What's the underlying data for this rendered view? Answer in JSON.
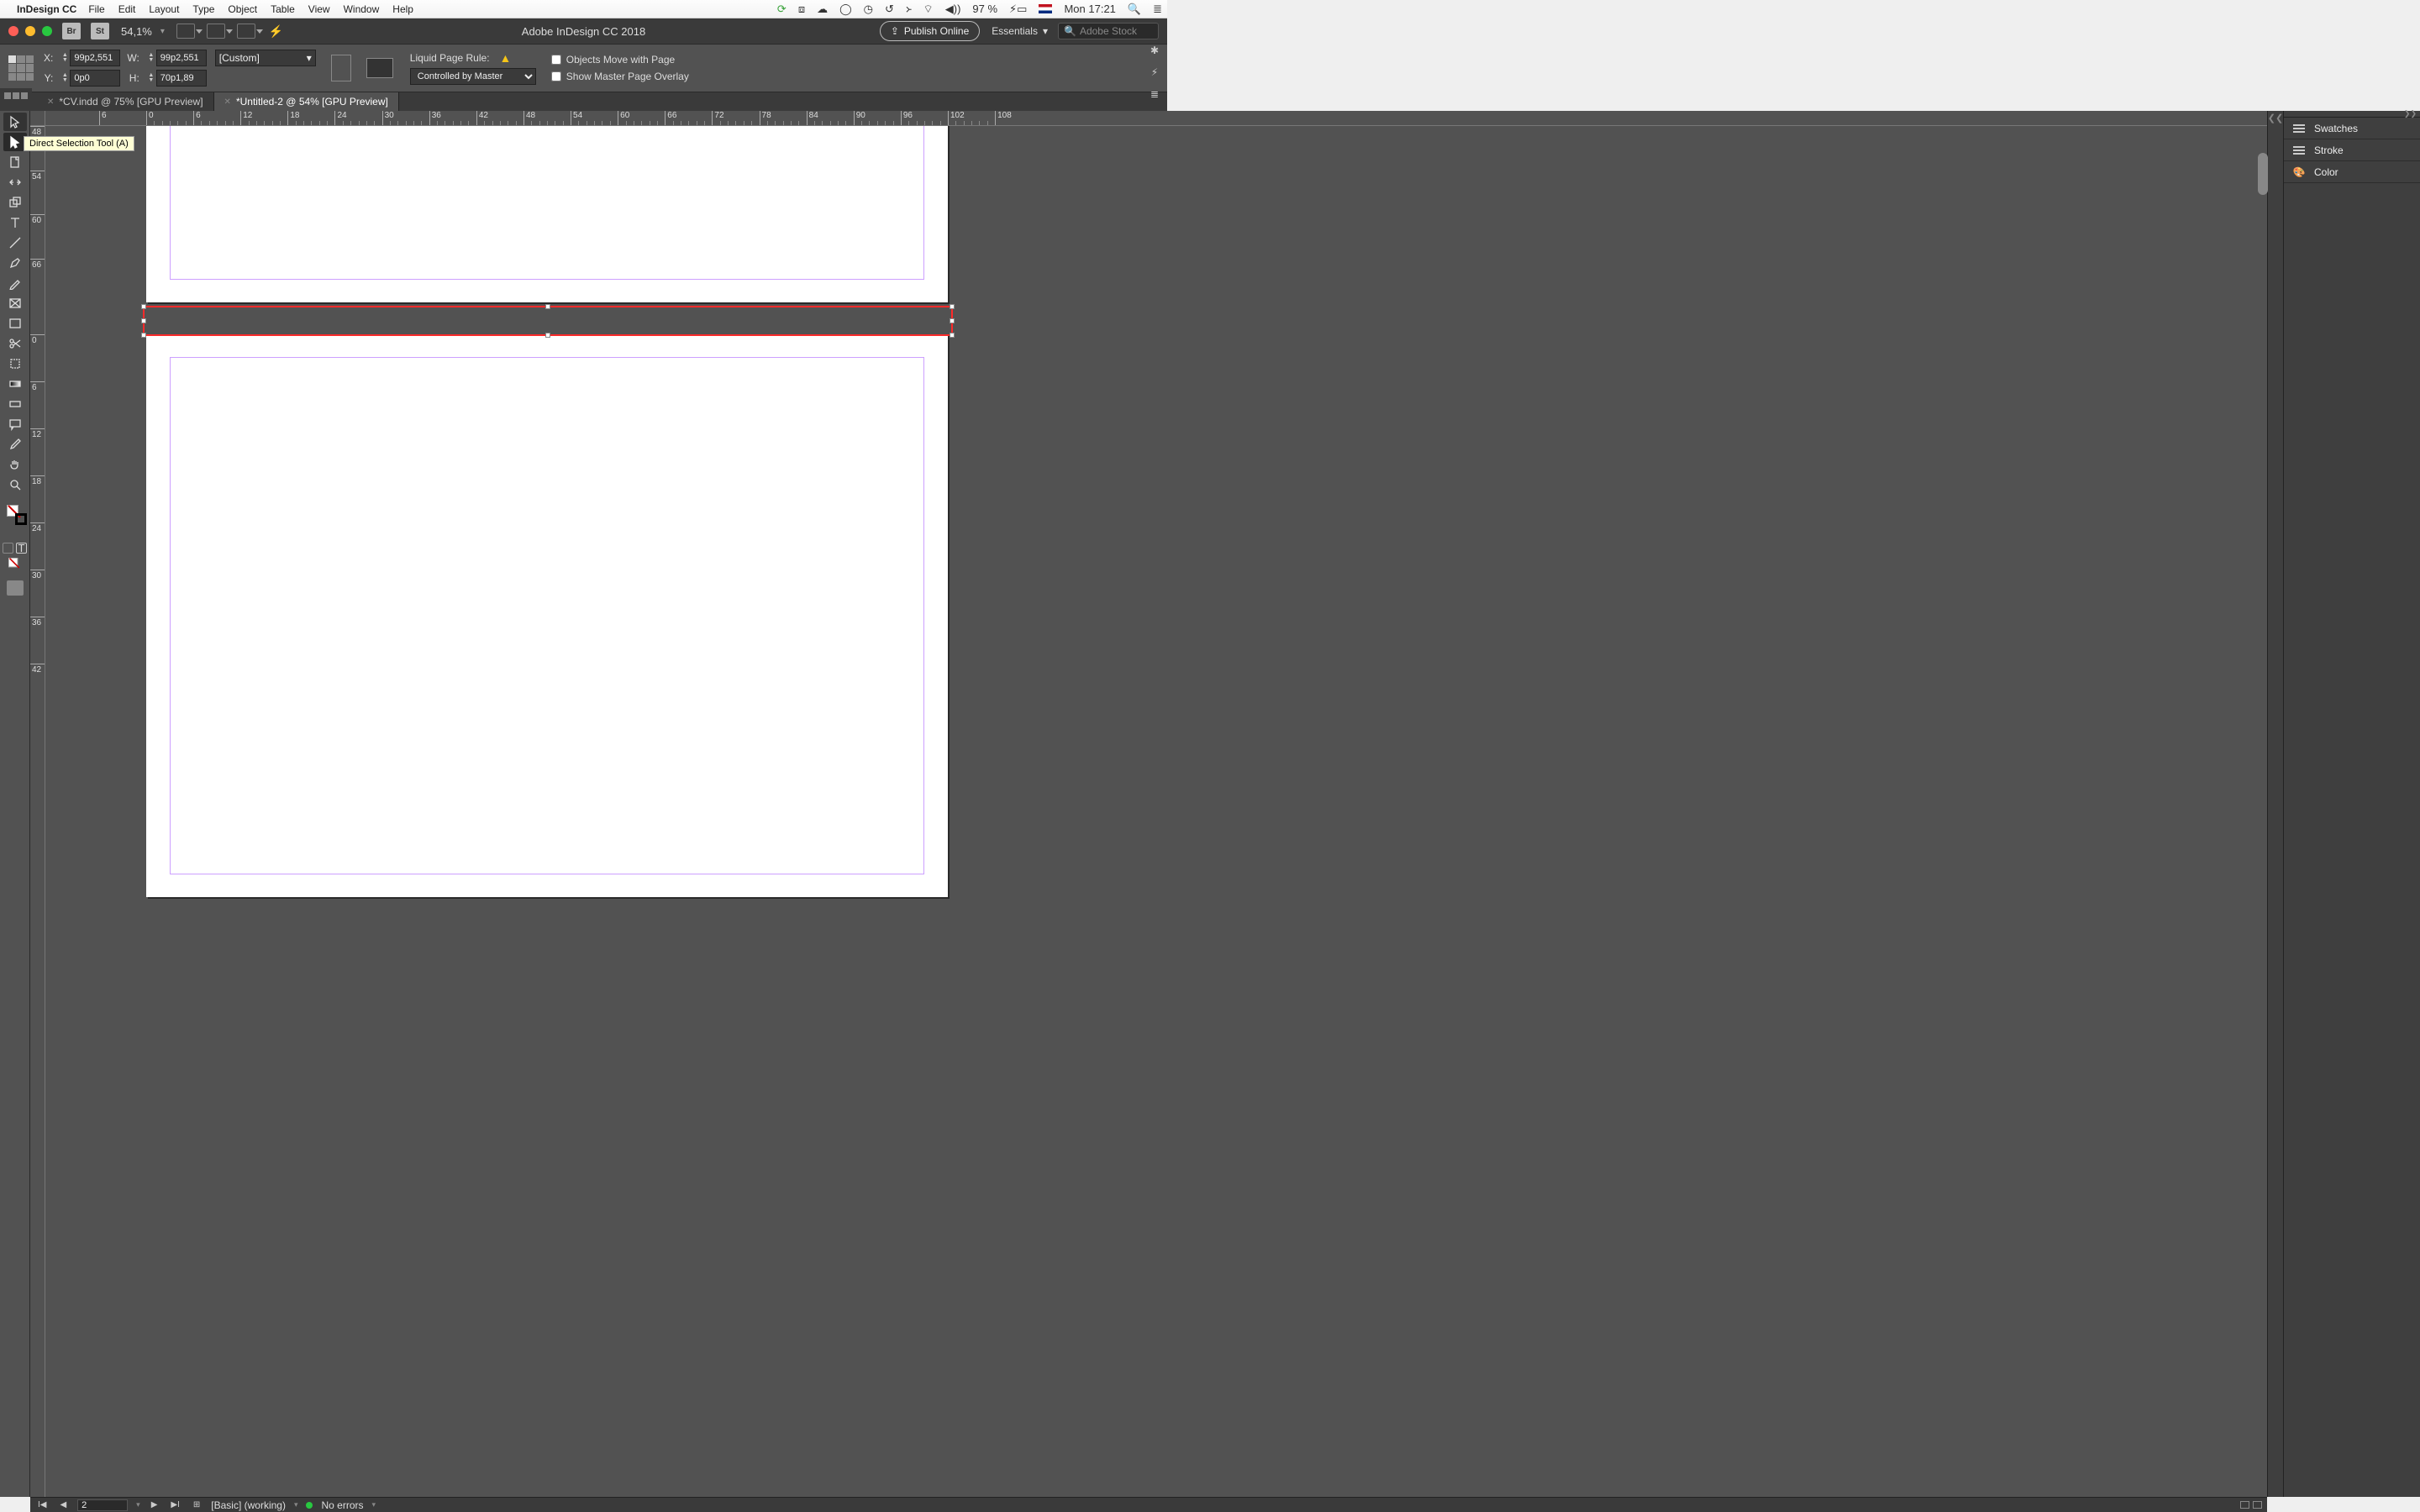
{
  "menubar": {
    "app": "InDesign CC",
    "items": [
      "File",
      "Edit",
      "Layout",
      "Type",
      "Object",
      "Table",
      "View",
      "Window",
      "Help"
    ],
    "right": {
      "battery": "97 %",
      "clock": "Mon 17:21"
    }
  },
  "titlebar": {
    "badges": [
      "Br",
      "St"
    ],
    "zoom": "54,1%",
    "title": "Adobe InDesign CC 2018",
    "publish": "Publish Online",
    "workspace": "Essentials",
    "search_placeholder": "Adobe Stock"
  },
  "control": {
    "x_label": "X:",
    "x": "99p2,551",
    "y_label": "Y:",
    "y": "0p0",
    "w_label": "W:",
    "w": "99p2,551",
    "h_label": "H:",
    "h": "70p1,89",
    "preset": "[Custom]",
    "liquid_label": "Liquid Page Rule:",
    "liquid_value": "Controlled by Master",
    "chk1": "Objects Move with Page",
    "chk2": "Show Master Page Overlay"
  },
  "tabs": [
    {
      "label": "*CV.indd @ 75% [GPU Preview]",
      "active": false
    },
    {
      "label": "*Untitled-2 @ 54% [GPU Preview]",
      "active": true
    }
  ],
  "tooltip": "Direct Selection Tool (A)",
  "ruler_h": [
    6,
    12,
    18,
    24,
    30,
    36,
    42,
    48,
    54,
    60,
    66,
    72,
    78,
    84,
    90,
    96,
    102,
    108
  ],
  "ruler_h_first": 6,
  "ruler_v": [
    48,
    54,
    60,
    66,
    6,
    12,
    18,
    24,
    30,
    36,
    42
  ],
  "panels": [
    "Swatches",
    "Stroke",
    "Color"
  ],
  "status": {
    "page": "2",
    "profile": "[Basic] (working)",
    "preflight": "No errors"
  }
}
